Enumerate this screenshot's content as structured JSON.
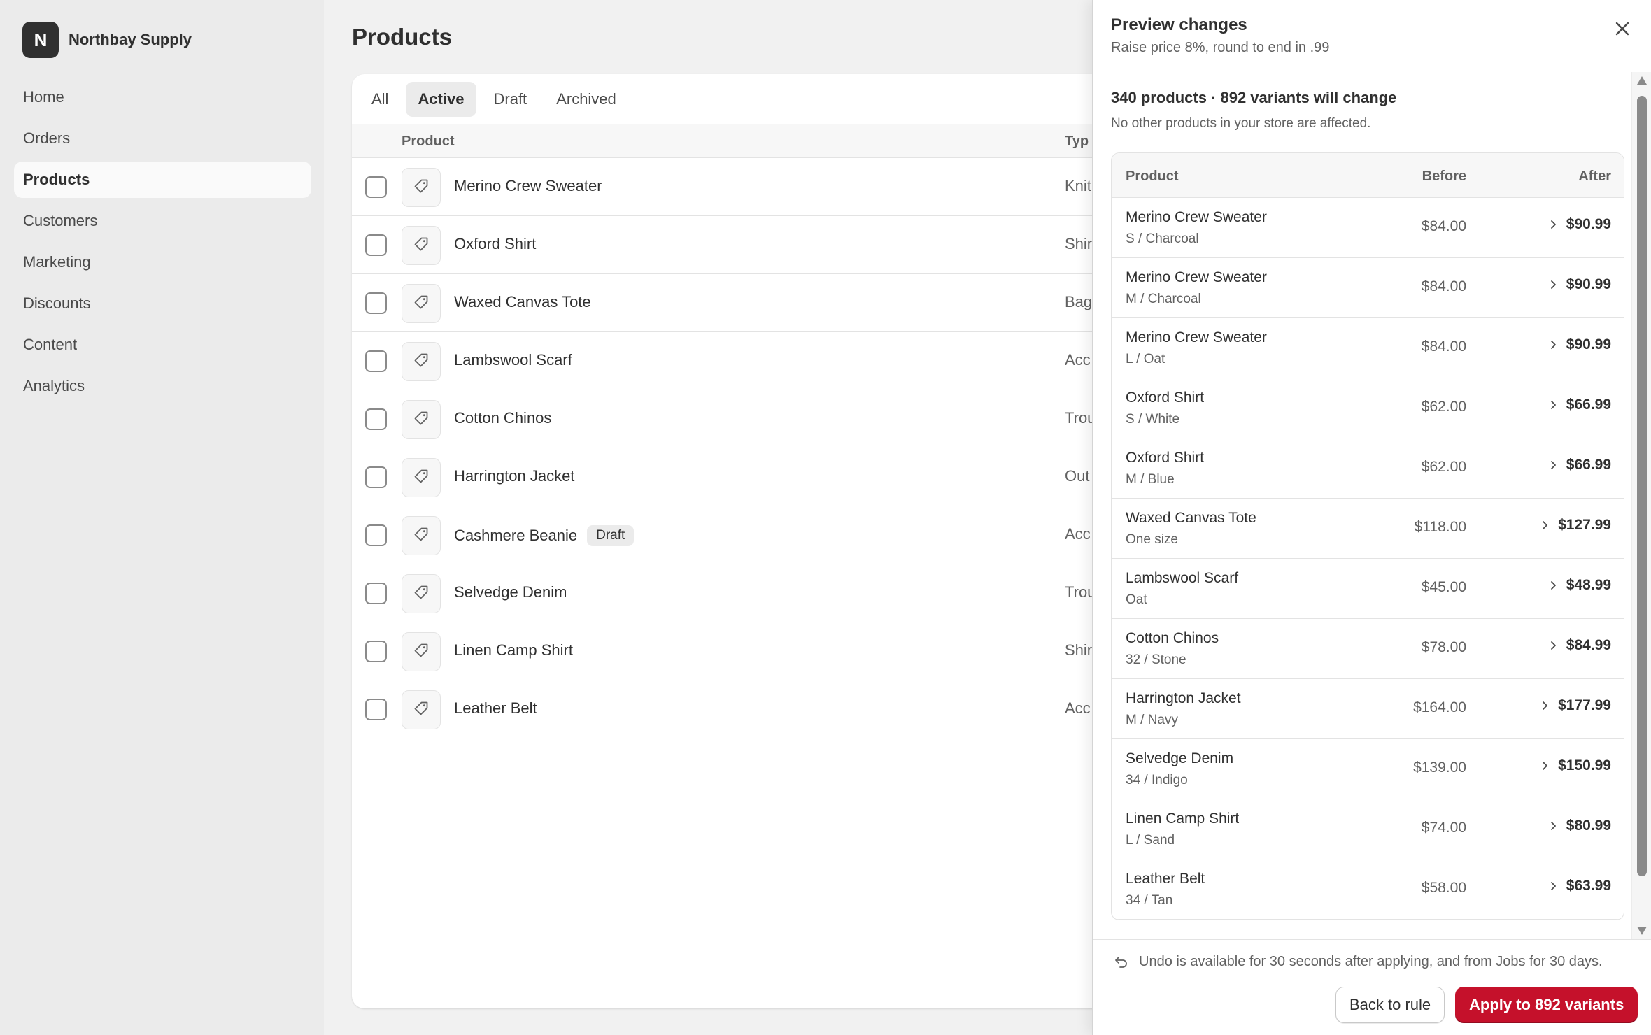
{
  "brand": {
    "logo_letter": "N",
    "name": "Northbay Supply"
  },
  "nav": {
    "items": [
      {
        "label": "Home",
        "active": false
      },
      {
        "label": "Orders",
        "active": false
      },
      {
        "label": "Products",
        "active": true
      },
      {
        "label": "Customers",
        "active": false
      },
      {
        "label": "Marketing",
        "active": false
      },
      {
        "label": "Discounts",
        "active": false
      },
      {
        "label": "Content",
        "active": false
      },
      {
        "label": "Analytics",
        "active": false
      }
    ]
  },
  "page": {
    "title": "Products"
  },
  "tabs": [
    {
      "label": "All",
      "active": false
    },
    {
      "label": "Active",
      "active": true
    },
    {
      "label": "Draft",
      "active": false
    },
    {
      "label": "Archived",
      "active": false
    }
  ],
  "table": {
    "headers": {
      "product": "Product",
      "type": "Typ"
    },
    "rows": [
      {
        "name": "Merino Crew Sweater",
        "badge": "",
        "type": "Knit"
      },
      {
        "name": "Oxford Shirt",
        "badge": "",
        "type": "Shir"
      },
      {
        "name": "Waxed Canvas Tote",
        "badge": "",
        "type": "Bag"
      },
      {
        "name": "Lambswool Scarf",
        "badge": "",
        "type": "Acc"
      },
      {
        "name": "Cotton Chinos",
        "badge": "",
        "type": "Trou"
      },
      {
        "name": "Harrington Jacket",
        "badge": "",
        "type": "Out"
      },
      {
        "name": "Cashmere Beanie",
        "badge": "Draft",
        "type": "Acc"
      },
      {
        "name": "Selvedge Denim",
        "badge": "",
        "type": "Trou"
      },
      {
        "name": "Linen Camp Shirt",
        "badge": "",
        "type": "Shir"
      },
      {
        "name": "Leather Belt",
        "badge": "",
        "type": "Acc"
      }
    ]
  },
  "preview": {
    "title": "Preview changes",
    "subtitle": "Raise price 8%, round to end in .99",
    "summary_title": "340 products · 892 variants will change",
    "summary_note": "No other products in your store are affected.",
    "headers": {
      "product": "Product",
      "before": "Before",
      "after": "After"
    },
    "rows": [
      {
        "name": "Merino Crew Sweater",
        "variant": "S / Charcoal",
        "before": "$84.00",
        "after": "$90.99"
      },
      {
        "name": "Merino Crew Sweater",
        "variant": "M / Charcoal",
        "before": "$84.00",
        "after": "$90.99"
      },
      {
        "name": "Merino Crew Sweater",
        "variant": "L / Oat",
        "before": "$84.00",
        "after": "$90.99"
      },
      {
        "name": "Oxford Shirt",
        "variant": "S / White",
        "before": "$62.00",
        "after": "$66.99"
      },
      {
        "name": "Oxford Shirt",
        "variant": "M / Blue",
        "before": "$62.00",
        "after": "$66.99"
      },
      {
        "name": "Waxed Canvas Tote",
        "variant": "One size",
        "before": "$118.00",
        "after": "$127.99"
      },
      {
        "name": "Lambswool Scarf",
        "variant": "Oat",
        "before": "$45.00",
        "after": "$48.99"
      },
      {
        "name": "Cotton Chinos",
        "variant": "32 / Stone",
        "before": "$78.00",
        "after": "$84.99"
      },
      {
        "name": "Harrington Jacket",
        "variant": "M / Navy",
        "before": "$164.00",
        "after": "$177.99"
      },
      {
        "name": "Selvedge Denim",
        "variant": "34 / Indigo",
        "before": "$139.00",
        "after": "$150.99"
      },
      {
        "name": "Linen Camp Shirt",
        "variant": "L / Sand",
        "before": "$74.00",
        "after": "$80.99"
      },
      {
        "name": "Leather Belt",
        "variant": "34 / Tan",
        "before": "$58.00",
        "after": "$63.99"
      }
    ],
    "undo_note": "Undo is available for 30 seconds after applying, and from Jobs for 30 days.",
    "back_label": "Back to rule",
    "apply_label": "Apply to 892 variants"
  },
  "icons": {
    "tag": "tag-icon",
    "close": "close-icon",
    "chevron": "chevron-right-icon",
    "undo": "undo-icon"
  },
  "colors": {
    "primary_button": "#c5112b",
    "sidebar_bg": "#ebebeb",
    "page_bg": "#f1f1f1"
  }
}
